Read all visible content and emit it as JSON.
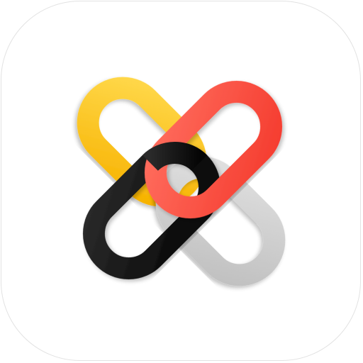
{
  "app_icon": {
    "tile_color": "#ffffff",
    "tile_border_color": "#e2e2e2",
    "icon": "chain-links-x-icon",
    "links": [
      {
        "name": "yellow-link",
        "color": "#ffc61a",
        "shade": "#f2a900"
      },
      {
        "name": "gray-link",
        "color": "#d2d2d2",
        "shade": "#b4b4b4"
      },
      {
        "name": "black-link",
        "color": "#141414",
        "shade": "#000000"
      },
      {
        "name": "red-link",
        "color": "#ff5a4c",
        "shade": "#f0382c"
      }
    ]
  }
}
